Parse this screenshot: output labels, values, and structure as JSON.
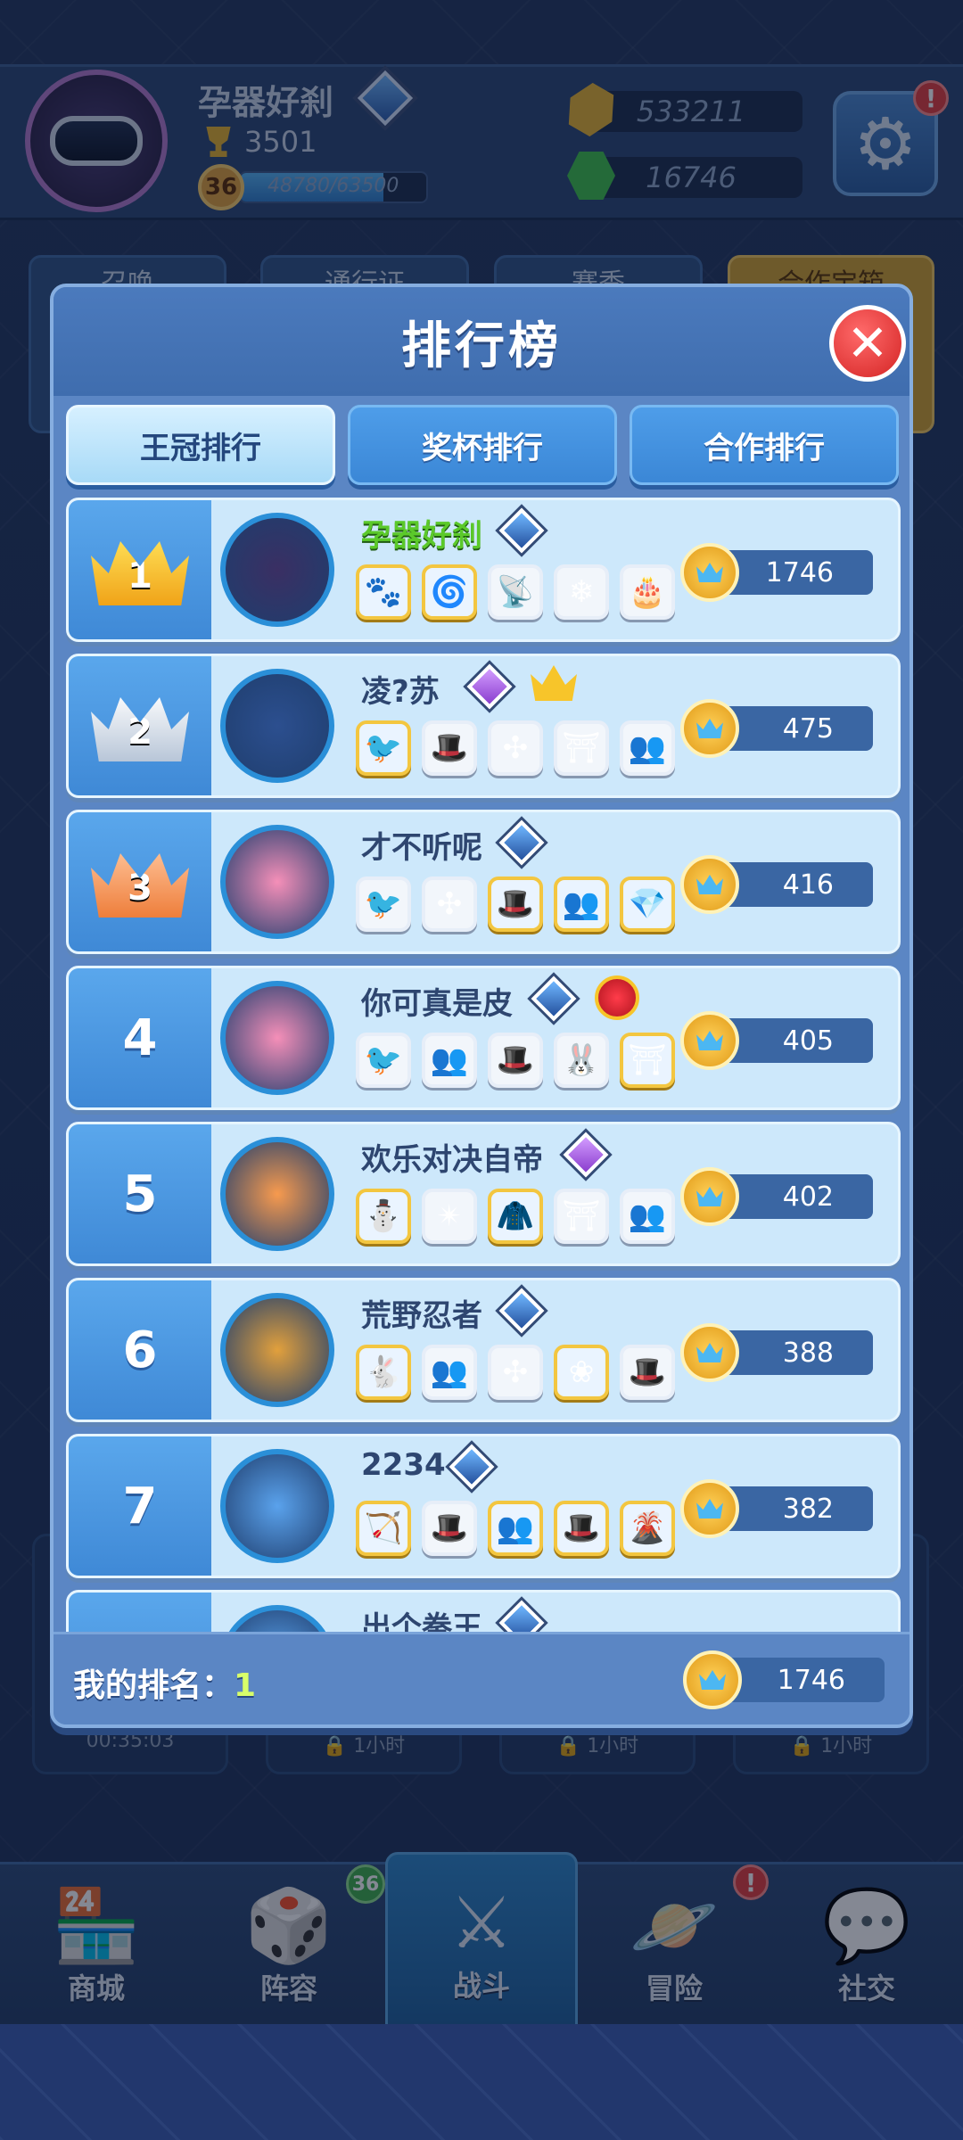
{
  "profile": {
    "name": "孕器好刹",
    "trophies": "3501",
    "level": "36",
    "xp": "48780/63500",
    "xp_fraction": 0.768,
    "gold": "533211",
    "gems": "16746"
  },
  "background_tabs": [
    "召唤",
    "通行证",
    "赛季",
    "合作宝箱"
  ],
  "background_timers": [
    "00:35:03",
    "1小时",
    "1小时",
    "1小时"
  ],
  "leaderboard": {
    "title": "排行榜",
    "tabs": [
      {
        "label": "王冠排行",
        "active": true
      },
      {
        "label": "奖杯排行",
        "active": false
      },
      {
        "label": "合作排行",
        "active": false
      }
    ],
    "rows": [
      {
        "rank": "1",
        "name": "孕器好刹",
        "score": "1746",
        "avatar_icon": "visor-helmet-icon",
        "avatar_color": "#3a2f63",
        "badges": [
          "diamond"
        ],
        "cards": [
          "🐾",
          "🌀",
          "📡",
          "❄",
          "🎂"
        ],
        "card_tiers": [
          "gold",
          "gold",
          "silver",
          "silver",
          "silver"
        ],
        "is_me": true
      },
      {
        "rank": "2",
        "name": "凌?苏",
        "score": "475",
        "avatar_icon": "silver-trophy-icon",
        "avatar_color": "#2c4f8f",
        "badges": [
          "purple",
          "crown"
        ],
        "cards": [
          "🐦",
          "🎩",
          "✣",
          "⛩",
          "👥"
        ],
        "card_tiers": [
          "gold",
          "silver",
          "silver",
          "silver",
          "silver"
        ],
        "is_me": false
      },
      {
        "rank": "3",
        "name": "才不听呢",
        "score": "416",
        "avatar_icon": "pink-blob-icon",
        "avatar_color": "#f58fb8",
        "badges": [
          "diamond"
        ],
        "cards": [
          "🐦",
          "✣",
          "🎩",
          "👥",
          "💎"
        ],
        "card_tiers": [
          "silver",
          "silver",
          "gold",
          "gold",
          "gold"
        ],
        "is_me": false
      },
      {
        "rank": "4",
        "name": "你可真是皮",
        "score": "405",
        "avatar_icon": "pink-blob-icon",
        "avatar_color": "#f58fb8",
        "badges": [
          "diamond",
          "heart"
        ],
        "cards": [
          "🐦",
          "👥",
          "🎩",
          "🐰",
          "⛩"
        ],
        "card_tiers": [
          "silver",
          "silver",
          "silver",
          "silver",
          "gold"
        ],
        "is_me": false
      },
      {
        "rank": "5",
        "name": "欢乐对决自帝",
        "score": "402",
        "avatar_icon": "orange-spirit-icon",
        "avatar_color": "#f79a4e",
        "badges": [
          "purple"
        ],
        "cards": [
          "⛄",
          "✴",
          "🧥",
          "⛩",
          "👥"
        ],
        "card_tiers": [
          "gold",
          "silver",
          "gold",
          "silver",
          "silver"
        ],
        "is_me": false
      },
      {
        "rank": "6",
        "name": "荒野忍者",
        "score": "388",
        "avatar_icon": "gold-medal-icon",
        "avatar_color": "#e2a03c",
        "badges": [
          "diamond"
        ],
        "cards": [
          "🐇",
          "👥",
          "✣",
          "❀",
          "🎩"
        ],
        "card_tiers": [
          "gold",
          "silver",
          "silver",
          "gold",
          "silver"
        ],
        "is_me": false
      },
      {
        "rank": "7",
        "name": "2234",
        "score": "382",
        "avatar_icon": "diamond-emblem-icon",
        "avatar_color": "#5aa2ec",
        "badges": [
          "diamond"
        ],
        "cards": [
          "🏹",
          "🎩",
          "👥",
          "🎩",
          "🌋"
        ],
        "card_tiers": [
          "gold",
          "silver",
          "gold",
          "gold",
          "gold"
        ],
        "is_me": false
      },
      {
        "rank": "",
        "name": "出个拳王",
        "score": "",
        "avatar_icon": "diamond-emblem-icon",
        "avatar_color": "#5aa2ec",
        "badges": [
          "diamond"
        ],
        "cards": [],
        "card_tiers": [],
        "is_me": false
      }
    ],
    "my_rank_label": "我的排名：",
    "my_rank_value": "1",
    "my_score": "1746"
  },
  "bottom_nav": [
    {
      "label": "商城",
      "icon": "shop-icon",
      "glyph": "🏪",
      "badge": ""
    },
    {
      "label": "阵容",
      "icon": "dice-icon",
      "glyph": "🎲",
      "badge": "36"
    },
    {
      "label": "战斗",
      "icon": "swords-icon",
      "glyph": "⚔",
      "badge": "",
      "active": true
    },
    {
      "label": "冒险",
      "icon": "planet-icon",
      "glyph": "🪐",
      "badge": "!"
    },
    {
      "label": "社交",
      "icon": "chat-icon",
      "glyph": "💬",
      "badge": ""
    }
  ],
  "colors": {
    "accent": "#3f89d6",
    "me_name": "#5bc92a",
    "close": "#d42424"
  }
}
